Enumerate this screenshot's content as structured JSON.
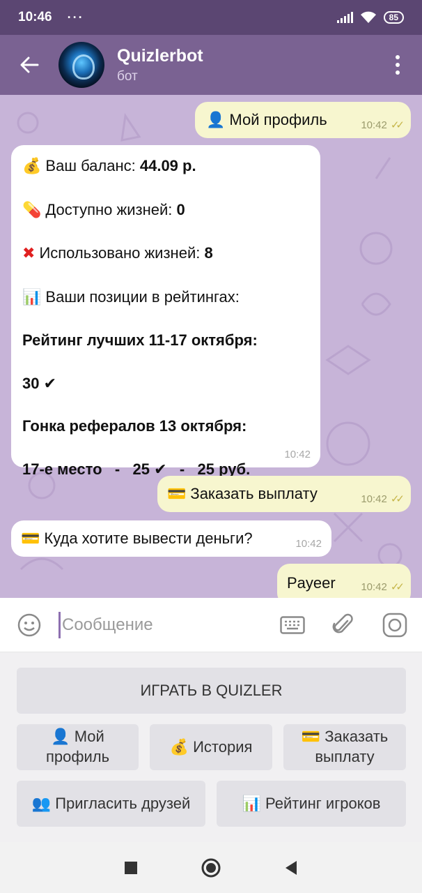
{
  "status": {
    "time": "10:46",
    "dots": "···",
    "battery": "85"
  },
  "header": {
    "title": "Quizlerbot",
    "subtitle": "бот"
  },
  "messages": [
    {
      "type": "out",
      "icon": "👤",
      "text": "Мой профиль",
      "time": "10:42"
    },
    {
      "type": "in",
      "lines": {
        "balance_label": "Ваш баланс: ",
        "balance_value": "44.09 р.",
        "lives_label": "Доступно жизней: ",
        "lives_value": "0",
        "used_label": "Использовано жизней: ",
        "used_value": "8",
        "positions": "Ваши позиции в рейтингах:",
        "rating_title": "Рейтинг лучших 11-17 октября:",
        "rating_value": "30 ✔",
        "race_title": "Гонка рефералов 13 октября:",
        "race_value": "17-е место   -   25 ✔   -   25 руб."
      },
      "time": "10:42"
    },
    {
      "type": "out",
      "icon": "💳",
      "text": "Заказать выплату",
      "time": "10:42"
    },
    {
      "type": "in",
      "icon": "💳",
      "text": "Куда хотите вывести деньги?",
      "time": "10:42"
    },
    {
      "type": "out",
      "text": "Payeer",
      "time": "10:42"
    }
  ],
  "input": {
    "placeholder": "Сообщение"
  },
  "keyboard": {
    "play": "ИГРАТЬ В QUIZLER",
    "profile_1": "👤 Мой",
    "profile_2": "профиль",
    "history": "💰 История",
    "payout_1": "💳 Заказать",
    "payout_2": "выплату",
    "invite": "👥 Пригласить друзей",
    "rating": "📊 Рейтинг игроков"
  },
  "colors": {
    "header": "#7a6292",
    "statusbar": "#5b4672",
    "chat_bg": "#c7b4d8",
    "outgoing": "#f7f6cf",
    "incoming": "#ffffff"
  }
}
